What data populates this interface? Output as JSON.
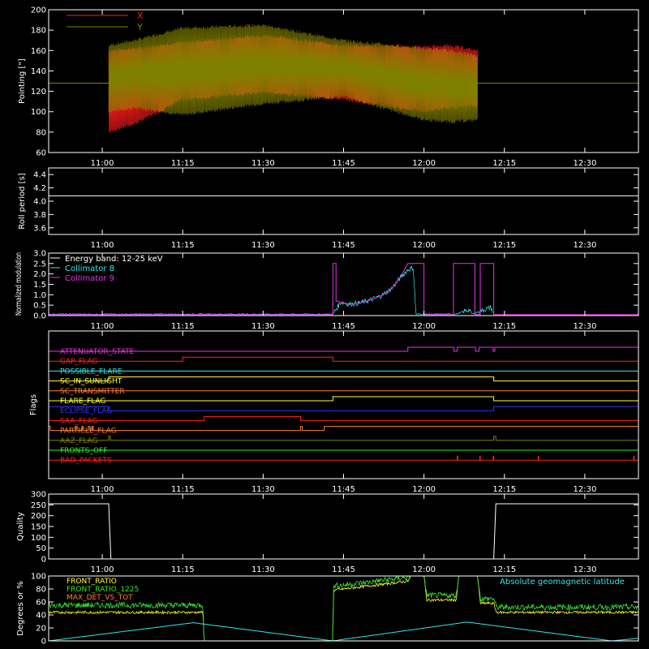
{
  "colors": {
    "background": "#000000",
    "axes": "#ffffff",
    "x_series": "#ff1a1a",
    "y_series": "#808000",
    "white": "#ffffff",
    "cyan": "#33e6e6",
    "magenta": "#e633e6"
  },
  "time_axis": {
    "range_min": [
      650,
      760
    ],
    "ticks_min": [
      660,
      675,
      690,
      705,
      720,
      735,
      750
    ],
    "tick_labels": [
      "11:00",
      "11:15",
      "11:30",
      "11:45",
      "12:00",
      "12:15",
      "12:30"
    ]
  },
  "chart_data": [
    {
      "type": "line",
      "ylabel": "Pointing [\"]",
      "ylim": [
        60,
        200
      ],
      "yticks": [
        60,
        80,
        100,
        120,
        140,
        160,
        180,
        200
      ],
      "legend": {
        "placement": "top-left",
        "entries": [
          "X",
          "Y"
        ]
      },
      "series": [
        {
          "name": "X",
          "baseline": 128,
          "x_min": [
            661.2,
            666,
            675,
            690,
            705,
            720,
            725,
            730
          ],
          "upper": [
            160,
            162,
            168,
            175,
            165,
            164,
            165,
            160
          ],
          "lower": [
            80,
            88,
            112,
            119,
            112,
            100,
            104,
            106
          ]
        },
        {
          "name": "Y",
          "baseline": 128,
          "x_min": [
            661.2,
            666,
            675,
            690,
            705,
            720,
            725,
            730
          ],
          "upper": [
            165,
            170,
            182,
            185,
            170,
            162,
            160,
            155
          ],
          "lower": [
            100,
            104,
            97,
            108,
            115,
            92,
            90,
            92
          ]
        }
      ]
    },
    {
      "type": "line",
      "ylabel": "Roll period [s]",
      "ylim": [
        3.5,
        4.5
      ],
      "yticks": [
        3.6,
        3.8,
        4.0,
        4.2,
        4.4
      ],
      "series": [
        {
          "x_min": [
            650,
            760
          ],
          "y": [
            4.08,
            4.08
          ]
        }
      ]
    },
    {
      "type": "line",
      "ylabel": "Normalized modulation",
      "ylim": [
        0,
        3.0
      ],
      "yticks": [
        0.0,
        0.5,
        1.0,
        1.5,
        2.0,
        2.5,
        3.0
      ],
      "legend": {
        "placement": "top-left",
        "entries": [
          "Energy band: 12-25 keV",
          "Collimator 8",
          "Collimator 9"
        ]
      },
      "series": [
        {
          "name": "Collimator 8",
          "x_min": [
            650,
            703,
            704.5,
            706,
            708,
            710,
            712,
            714,
            715.5,
            717,
            718,
            718.5,
            720,
            726,
            728.5,
            729,
            732.5,
            733
          ],
          "y": [
            0.07,
            0.07,
            0.65,
            0.55,
            0.6,
            0.75,
            0.95,
            1.3,
            1.8,
            2.2,
            2.3,
            0.07,
            0.07,
            0.07,
            0.3,
            0.07,
            0.4,
            0.07
          ]
        },
        {
          "name": "Collimator 9",
          "steps": [
            [
              650,
              0.05
            ],
            [
              703,
              0.05
            ],
            [
              703,
              2.5
            ],
            [
              703.6,
              2.5
            ],
            [
              703.6,
              0.7
            ],
            [
              706,
              0.55
            ],
            [
              708,
              0.6
            ],
            [
              710,
              0.75
            ],
            [
              712,
              0.95
            ],
            [
              714,
              1.3
            ],
            [
              715.5,
              1.8
            ],
            [
              717,
              2.5
            ],
            [
              720,
              2.5
            ],
            [
              720,
              0.05
            ],
            [
              725.5,
              0.05
            ],
            [
              725.5,
              2.5
            ],
            [
              729.5,
              2.5
            ],
            [
              729.5,
              0.05
            ],
            [
              730.5,
              0.05
            ],
            [
              730.5,
              2.5
            ],
            [
              733,
              2.5
            ],
            [
              733,
              0.05
            ],
            [
              760,
              0.05
            ]
          ]
        }
      ]
    },
    {
      "type": "line",
      "ylabel": "Flags",
      "flags": [
        {
          "name": "ATTENUATOR_STATE",
          "color": "#e633e6",
          "on_intervals": [
            [
              717,
              725.6
            ],
            [
              726.2,
              729.6
            ],
            [
              730.3,
              732.9
            ],
            [
              733.2,
              760
            ]
          ]
        },
        {
          "name": "GAP_FLAG",
          "color": "#ff2020",
          "on_intervals": [
            [
              675,
              703
            ]
          ]
        },
        {
          "name": "POSSIBLE_FLARE",
          "color": "#33e6e6",
          "on_intervals": []
        },
        {
          "name": "SC_IN_SUNLIGHT",
          "color": "#ffff33",
          "on_intervals": [
            [
              661.2,
              733
            ]
          ]
        },
        {
          "name": "SC_TRANSMITTER",
          "color": "#ff7f33",
          "on_intervals": []
        },
        {
          "name": "FLARE_FLAG",
          "color": "#ffff33",
          "on_intervals": [
            [
              703,
              733
            ]
          ]
        },
        {
          "name": "ECLIPSE_FLAG",
          "color": "#3333ff",
          "on_intervals": [
            [
              650,
              661.2
            ],
            [
              733,
              760
            ]
          ]
        },
        {
          "name": "SAA_FLAG",
          "color": "#ff2020",
          "on_intervals": [
            [
              679,
              697
            ]
          ]
        },
        {
          "name": "PARTICLE_FLAG",
          "color": "#ff7f33",
          "on_intervals": [
            [
              650,
              650.3
            ],
            [
              655,
              655.3
            ],
            [
              656.2,
              656.4
            ],
            [
              657.4,
              657.7
            ],
            [
              658.1,
              658.3
            ],
            [
              697,
              697.3
            ],
            [
              701.4,
              760
            ]
          ]
        },
        {
          "name": "AAZ_FLAG",
          "color": "#808000",
          "on_intervals": [
            [
              661.2,
              661.5
            ],
            [
              733,
              733.4
            ]
          ]
        },
        {
          "name": "FRONTS_OFF",
          "color": "#33e633",
          "on_intervals": []
        },
        {
          "name": "BAD_PACKETS",
          "color": "#ff2020",
          "on_intervals": [
            [
              726.2,
              726.3
            ],
            [
              730.4,
              730.5
            ],
            [
              732.9,
              733
            ],
            [
              741.3,
              741.4
            ],
            [
              759.1,
              759.2
            ]
          ]
        }
      ]
    },
    {
      "type": "line",
      "ylabel": "Quality",
      "ylim": [
        0,
        300
      ],
      "yticks": [
        0,
        50,
        100,
        150,
        200,
        250,
        300
      ],
      "series": [
        {
          "x_min": [
            650,
            661.2,
            661.6,
            733,
            733.4,
            760
          ],
          "y": [
            255,
            255,
            0,
            0,
            255,
            255
          ]
        }
      ]
    },
    {
      "type": "line",
      "ylabel": "Degrees or %",
      "ylim": [
        0,
        100
      ],
      "yticks": [
        0,
        20,
        40,
        60,
        80,
        100
      ],
      "legend": {
        "placement": "top-left",
        "entries": [
          "FRONT_RATIO",
          "FRONT_RATIO_1225",
          "MAX_DET_VS_TOT"
        ]
      },
      "annotation": "Absolute geomagnetic latitude",
      "series": [
        {
          "name": "FRONT_RATIO",
          "x_min": [
            650,
            678.8,
            679,
            703,
            703.1,
            705,
            717,
            717.5,
            720,
            720.5,
            726,
            726.5,
            730,
            730.5,
            733,
            733.5,
            760
          ],
          "y": [
            44,
            44,
            0,
            0,
            78,
            80,
            92,
            100,
            100,
            63,
            63,
            100,
            100,
            58,
            58,
            44,
            44
          ]
        },
        {
          "name": "FRONT_RATIO_1225",
          "x_min": [
            650,
            678.8,
            679,
            703,
            703.1,
            705,
            717,
            717.5,
            720,
            720.5,
            726,
            726.5,
            730,
            730.5,
            733,
            733.5,
            760
          ],
          "y": [
            55,
            55,
            0,
            0,
            85,
            86,
            98,
            100,
            100,
            70,
            70,
            100,
            100,
            65,
            65,
            52,
            52
          ]
        },
        {
          "name": "MAX_DET_VS_TOT",
          "x_min": [
            650,
            760
          ],
          "y": [
            0,
            0
          ]
        },
        {
          "name": "Absolute geomagnetic latitude",
          "x_min": [
            650,
            677,
            703,
            728,
            755,
            760
          ],
          "y": [
            0,
            28,
            0,
            29,
            0,
            4
          ]
        }
      ]
    }
  ]
}
